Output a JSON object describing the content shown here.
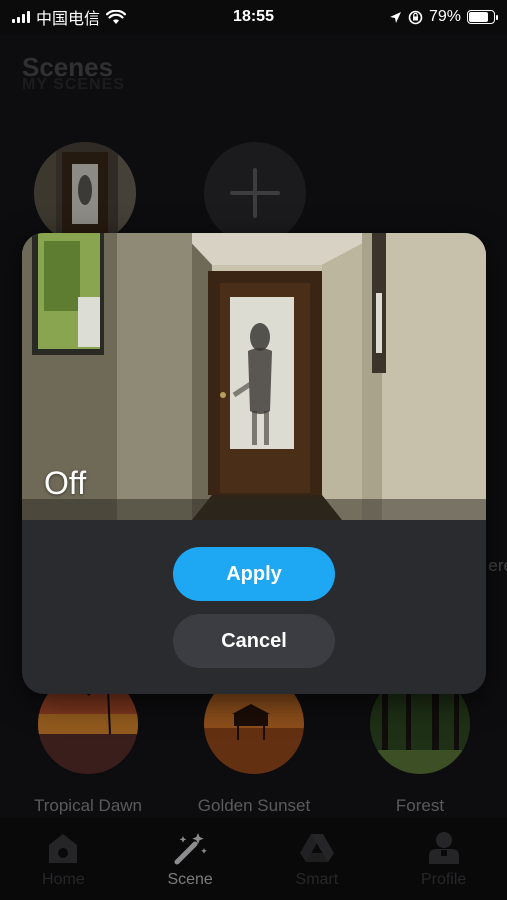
{
  "status_bar": {
    "carrier": "中国电信",
    "time": "18:55",
    "battery": "79%",
    "battery_level": 0.79
  },
  "page": {
    "title": "Scenes",
    "section": "MY SCENES"
  },
  "partial_label": "ere",
  "dialog": {
    "scene_name": "Off",
    "apply_label": "Apply",
    "cancel_label": "Cancel"
  },
  "scenes": [
    {
      "label": "Tropical Dawn"
    },
    {
      "label": "Golden Sunset"
    },
    {
      "label": "Forest"
    }
  ],
  "nav": [
    {
      "label": "Home",
      "icon": "home-icon"
    },
    {
      "label": "Scene",
      "icon": "magic-wand-icon",
      "active": true
    },
    {
      "label": "Smart",
      "icon": "smart-triangle-icon"
    },
    {
      "label": "Profile",
      "icon": "profile-icon"
    }
  ],
  "colors": {
    "accent": "#1ea7f2",
    "background": "#151517",
    "dialog": "#2a2b2f"
  }
}
